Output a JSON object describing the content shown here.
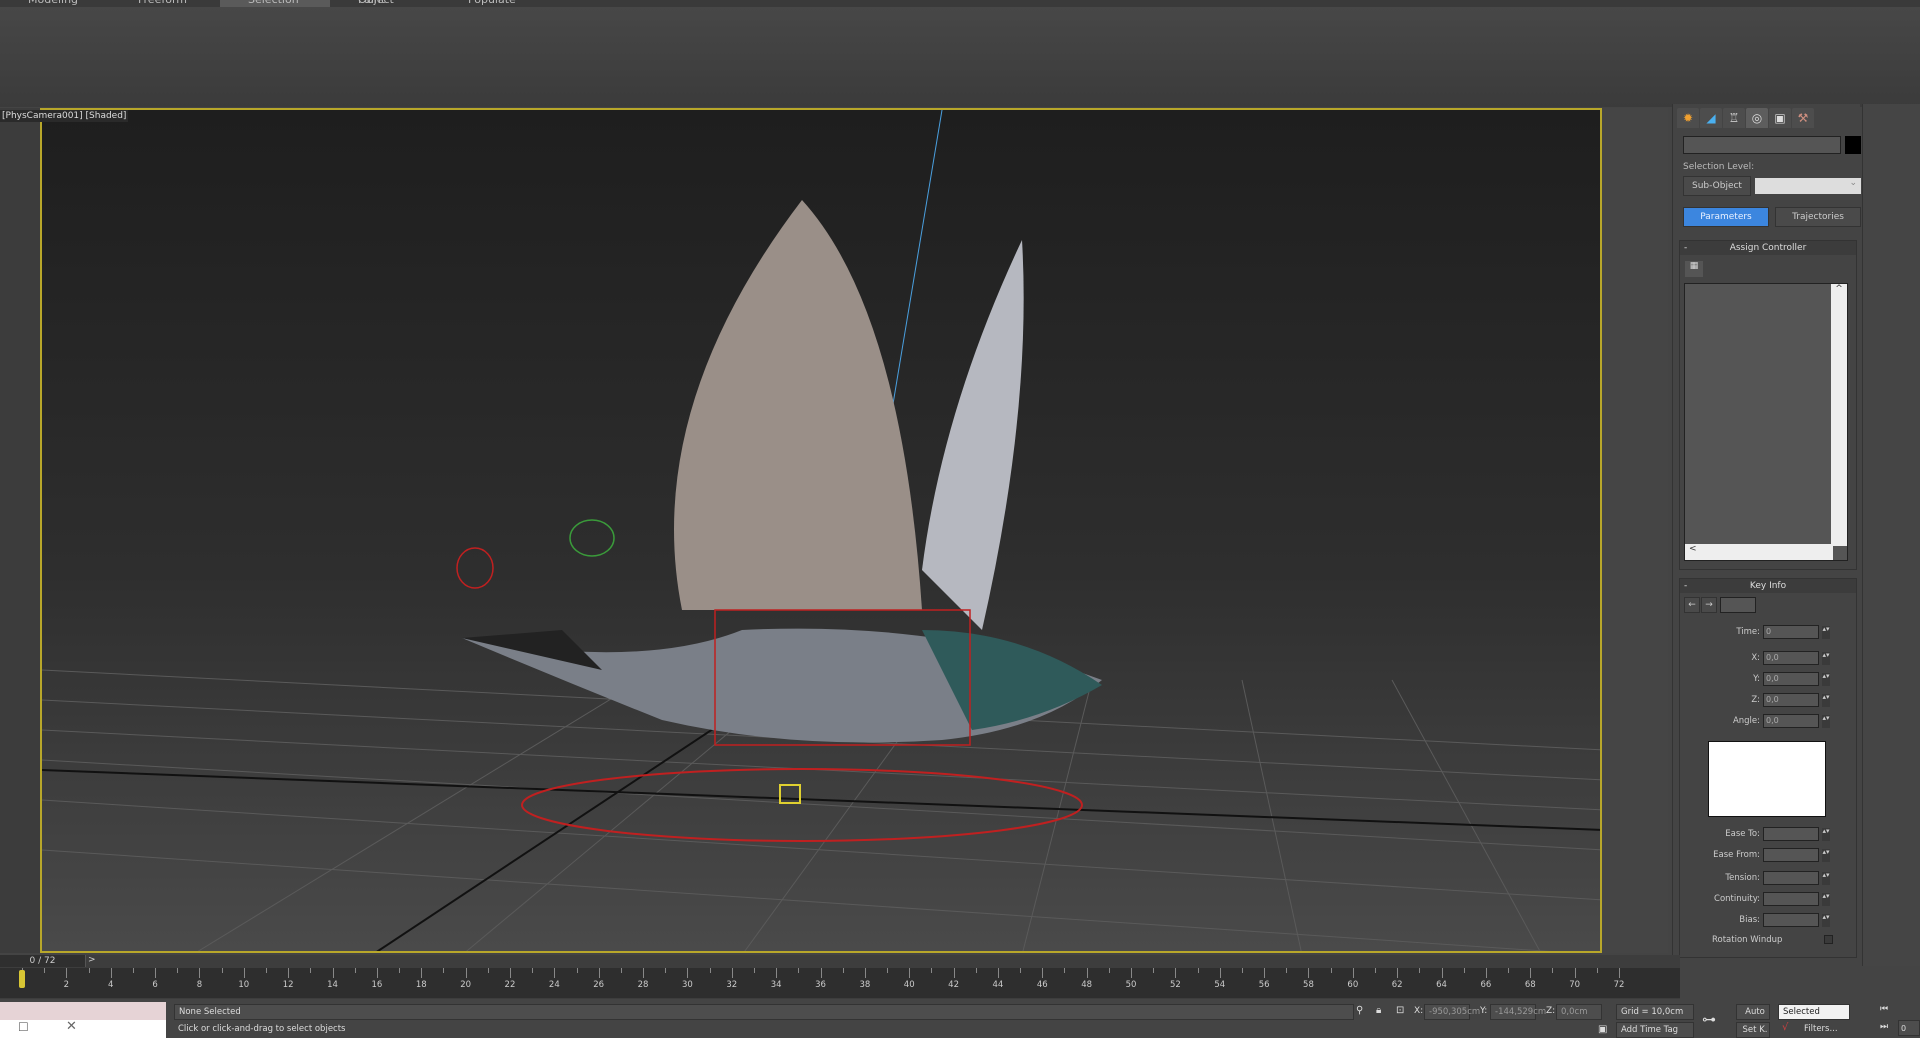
{
  "ribbon": {
    "tabs": [
      {
        "label": "Modeling"
      },
      {
        "label": "Freeform"
      },
      {
        "label": "Selection",
        "active": true
      },
      {
        "label": "Object Paint"
      },
      {
        "label": "Populate"
      }
    ]
  },
  "viewport": {
    "label_camera": "PhysCamera001",
    "label_text": "[PhysCamera001] [Shaded]",
    "border_color": "#b8a72a"
  },
  "command_panel": {
    "tabs": [
      {
        "icon": "create-icon"
      },
      {
        "icon": "modify-icon"
      },
      {
        "icon": "hierarchy-icon"
      },
      {
        "icon": "motion-icon",
        "active": true
      },
      {
        "icon": "display-icon"
      },
      {
        "icon": "utilities-icon"
      }
    ],
    "name_field": "",
    "color_swatch": "#000000",
    "selection_level_label": "Selection Level:",
    "sub_object_label": "Sub-Object",
    "sub_object_value": "",
    "parameters_label": "Parameters",
    "trajectories_label": "Trajectories",
    "assign_controller": {
      "title": "Assign Controller",
      "collapse": "-"
    },
    "key_info": {
      "title": "Key Info",
      "collapse": "-",
      "fields": [
        {
          "label": "Time:",
          "value": "0"
        },
        {
          "label": "X:",
          "value": "0,0"
        },
        {
          "label": "Y:",
          "value": "0,0"
        },
        {
          "label": "Z:",
          "value": "0,0"
        },
        {
          "label": "Angle:",
          "value": "0,0"
        }
      ],
      "fields2": [
        {
          "label": "Ease To:",
          "value": ""
        },
        {
          "label": "Ease From:",
          "value": ""
        },
        {
          "label": "Tension:",
          "value": ""
        },
        {
          "label": "Continuity:",
          "value": ""
        },
        {
          "label": "Bias:",
          "value": ""
        }
      ],
      "rotation_windup_label": "Rotation Windup",
      "rotation_windup_checked": false
    }
  },
  "timeline": {
    "frame_display": "0 / 72",
    "next_label": ">",
    "current_frame": 0,
    "start": 0,
    "end": 72,
    "tick_labels": [
      "0",
      "2",
      "4",
      "6",
      "8",
      "10",
      "12",
      "14",
      "16",
      "18",
      "20",
      "22",
      "24",
      "26",
      "28",
      "30",
      "32",
      "34",
      "36",
      "38",
      "40",
      "42",
      "44",
      "46",
      "48",
      "50",
      "52",
      "54",
      "56",
      "58",
      "60",
      "62",
      "64",
      "66",
      "68",
      "70",
      "72"
    ]
  },
  "status": {
    "selection": "None Selected",
    "prompt": "Click or click-and-drag to select objects",
    "x_label": "X:",
    "x_value": "-950,305cm",
    "y_label": "Y:",
    "y_value": "-144,529cm",
    "z_label": "Z:",
    "z_value": "0,0cm",
    "grid": "Grid = 10,0cm",
    "add_time_tag": "Add Time Tag",
    "auto_label": "Auto",
    "setkey_label": "Set K.",
    "key_filter": "Selected",
    "filters_label": "Filters...",
    "frame_field": "0"
  }
}
